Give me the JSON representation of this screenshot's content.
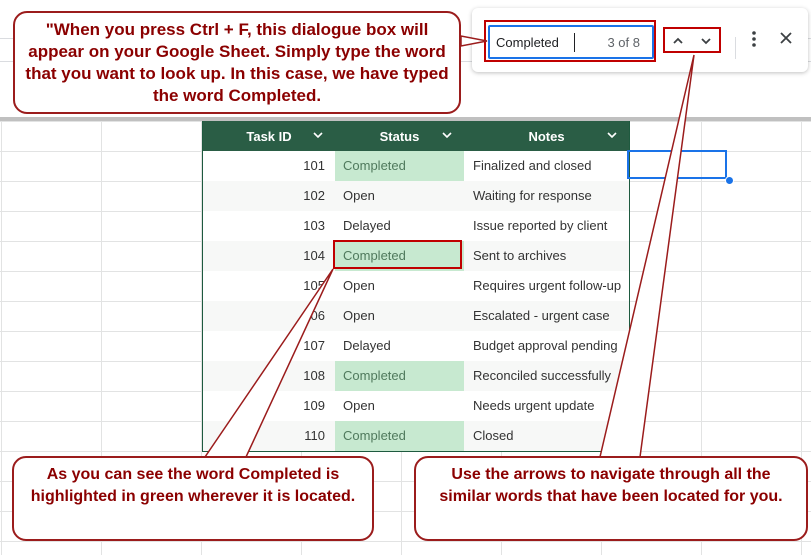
{
  "find_dialog": {
    "query": "Completed",
    "match_count": "3 of 8"
  },
  "table": {
    "headers": [
      "Task ID",
      "Status",
      "Notes"
    ],
    "rows": [
      {
        "id": "101",
        "status": "Completed",
        "notes": "Finalized and closed",
        "highlight": true
      },
      {
        "id": "102",
        "status": "Open",
        "notes": "Waiting for response",
        "highlight": false
      },
      {
        "id": "103",
        "status": "Delayed",
        "notes": "Issue reported by client",
        "highlight": false
      },
      {
        "id": "104",
        "status": "Completed",
        "notes": "Sent to archives",
        "highlight": true
      },
      {
        "id": "105",
        "status": "Open",
        "notes": "Requires urgent follow-up",
        "highlight": false
      },
      {
        "id": "06",
        "status": "Open",
        "notes": "Escalated - urgent case",
        "highlight": false
      },
      {
        "id": "107",
        "status": "Delayed",
        "notes": "Budget approval pending",
        "highlight": false
      },
      {
        "id": "108",
        "status": "Completed",
        "notes": "Reconciled successfully",
        "highlight": true
      },
      {
        "id": "109",
        "status": "Open",
        "notes": "Needs urgent update",
        "highlight": false
      },
      {
        "id": "110",
        "status": "Completed",
        "notes": "Closed",
        "highlight": true
      }
    ]
  },
  "callouts": {
    "top": "\"When you press Ctrl + F, this dialogue box will appear on your Google Sheet. Simply type the word that you want to look up. In this case, we have typed the word Completed.",
    "bottom_left": "As you can see the word Completed is highlighted in green wherever it is located.",
    "bottom_right": "Use the arrows to navigate through all the similar words that have been located for you."
  },
  "icons": {
    "prev": "chevron-up-icon",
    "next": "chevron-down-icon",
    "more": "more-vertical-icon",
    "close": "close-icon",
    "filter": "filter-chevron-icon"
  },
  "colors": {
    "header_bg": "#2a5d45",
    "highlight_bg": "#c7e9d0",
    "callout_text": "#8b0000",
    "accent": "#1a73e8"
  }
}
